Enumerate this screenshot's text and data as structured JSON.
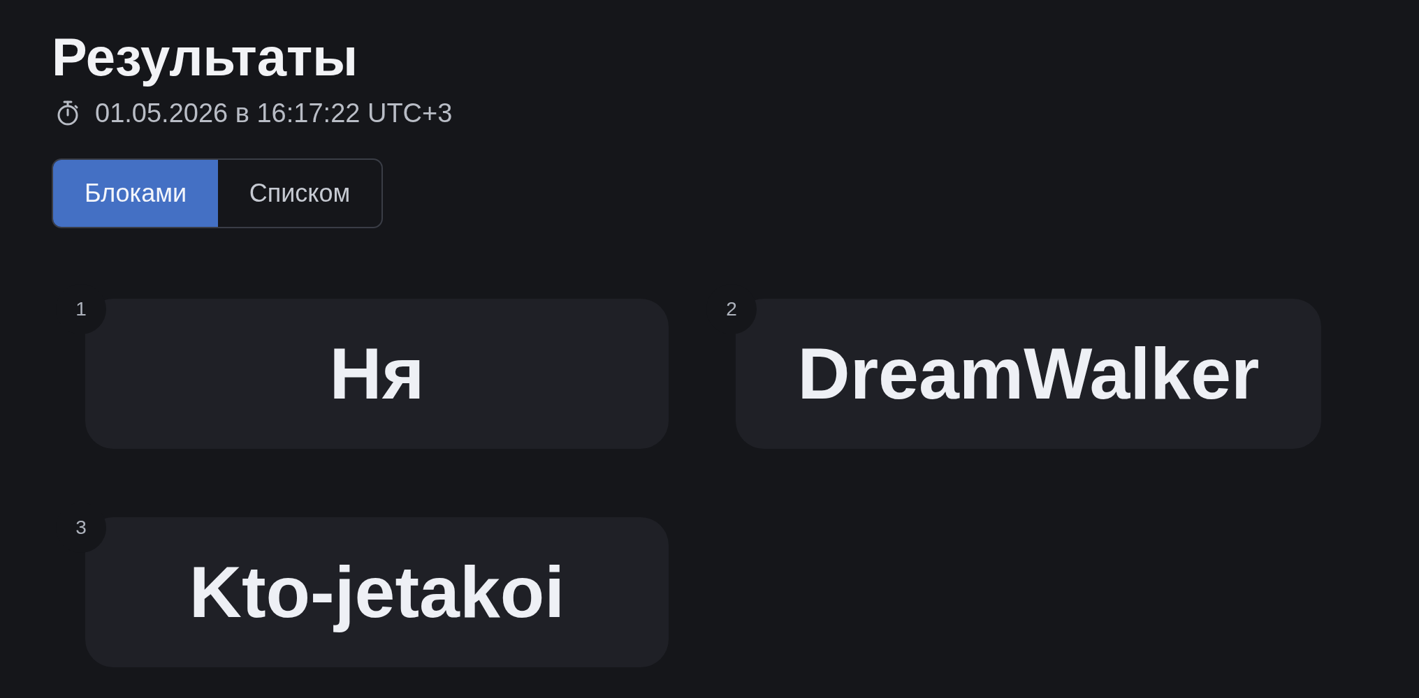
{
  "header": {
    "title": "Результаты",
    "timestamp": "01.05.2026 в 16:17:22 UTC+3"
  },
  "view_toggle": [
    {
      "label": "Блоками",
      "selected": true
    },
    {
      "label": "Списком",
      "selected": false
    }
  ],
  "results": [
    {
      "rank": "1",
      "name": "Ня"
    },
    {
      "rank": "2",
      "name": "DreamWalker"
    },
    {
      "rank": "3",
      "name": "Kto-jetakoi"
    }
  ]
}
